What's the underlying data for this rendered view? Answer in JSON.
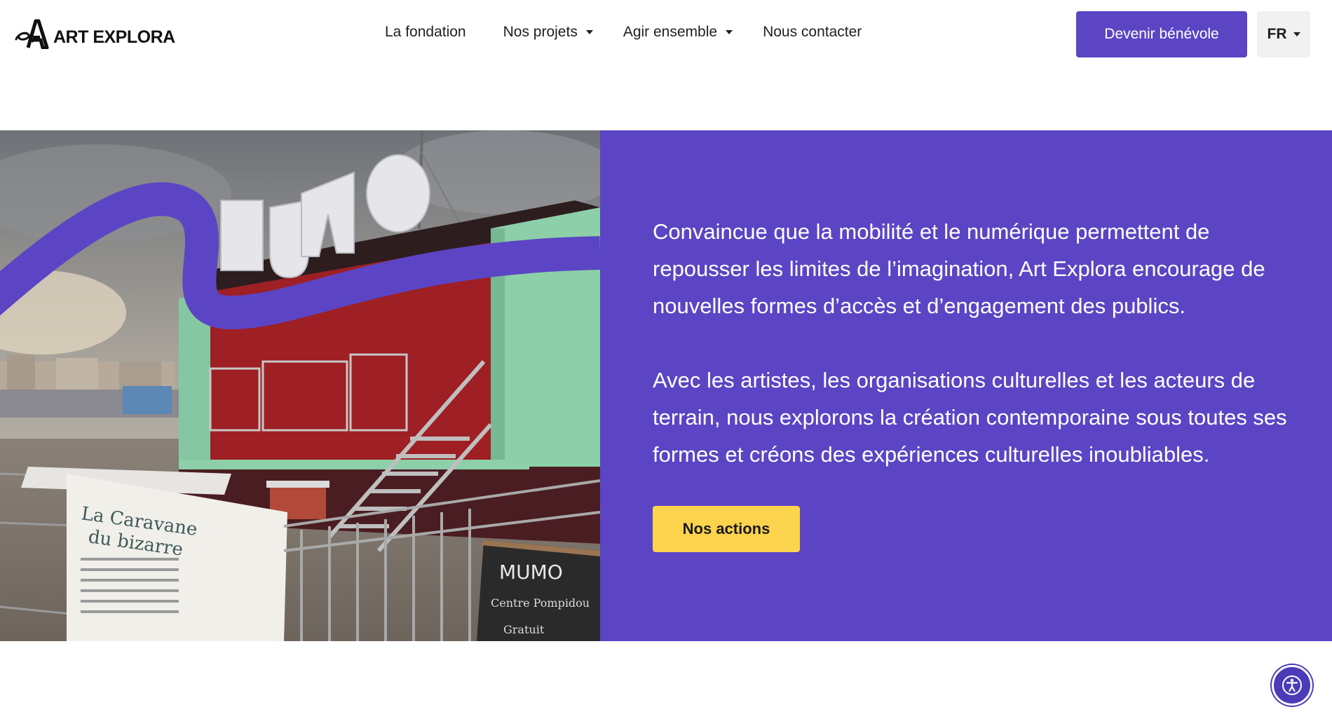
{
  "header": {
    "logo_text": "ART EXPLORA",
    "nav": [
      {
        "label": "La fondation"
      },
      {
        "label": "Nos projets"
      },
      {
        "label": "Agir ensemble"
      },
      {
        "label": "Nous contacter"
      }
    ],
    "cta_label": "Devenir bénévole",
    "language": "FR"
  },
  "hero": {
    "paragraph_1": "Convaincue que la mobilité et le numérique permettent de repousser les limites de l’imagination, Art Explora encourage de nouvelles formes d’accès et d’engagement des publics.",
    "paragraph_2": "Avec les artistes, les organisations culturelles et les acteurs de terrain, nous explorons la création contemporaine sous toutes ses formes et créons des expériences culturelles inoubliables.",
    "cta_label": "Nos actions",
    "photo": {
      "sign_letters": "MUMO",
      "banner_line_1": "La Caravane",
      "banner_line_2": "du bizarre",
      "chalkboard_title": "MUMO",
      "chalkboard_line_1": "Centre Pompidou",
      "chalkboard_line_2": "Gratuit"
    }
  },
  "colors": {
    "brand_purple": "#5b45c4",
    "accent_yellow": "#fcd34d",
    "white": "#ffffff"
  },
  "icons": [
    "art-explora-logo-icon",
    "caret-down-icon",
    "accessibility-icon"
  ]
}
